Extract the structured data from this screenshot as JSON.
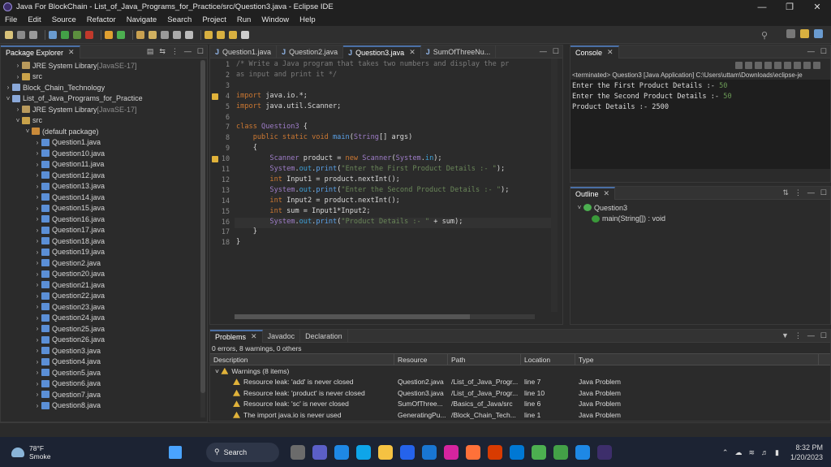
{
  "window": {
    "title": "Java For BlockChain - List_of_Java_Programs_for_Practice/src/Question3.java - Eclipse IDE",
    "minimize": "—",
    "restore": "❐",
    "close": "✕"
  },
  "menu": [
    "File",
    "Edit",
    "Source",
    "Refactor",
    "Navigate",
    "Search",
    "Project",
    "Run",
    "Window",
    "Help"
  ],
  "package_explorer": {
    "tab": "Package Explorer",
    "items": [
      {
        "indent": 1,
        "arrow": "›",
        "label": "JRE System Library",
        "suffix": " [JavaSE-17]"
      },
      {
        "indent": 1,
        "arrow": "›",
        "label": "src",
        "suffix": ""
      },
      {
        "indent": 0,
        "arrow": "›",
        "label": "Block_Chain_Technology",
        "suffix": ""
      },
      {
        "indent": 0,
        "arrow": "˅",
        "label": "List_of_Java_Programs_for_Practice",
        "suffix": ""
      },
      {
        "indent": 1,
        "arrow": "›",
        "label": "JRE System Library",
        "suffix": " [JavaSE-17]"
      },
      {
        "indent": 1,
        "arrow": "˅",
        "label": "src",
        "suffix": ""
      },
      {
        "indent": 2,
        "arrow": "˅",
        "label": "(default package)",
        "suffix": ""
      },
      {
        "indent": 3,
        "arrow": "›",
        "label": "Question1.java",
        "suffix": ""
      },
      {
        "indent": 3,
        "arrow": "›",
        "label": "Question10.java",
        "suffix": ""
      },
      {
        "indent": 3,
        "arrow": "›",
        "label": "Question11.java",
        "suffix": ""
      },
      {
        "indent": 3,
        "arrow": "›",
        "label": "Question12.java",
        "suffix": ""
      },
      {
        "indent": 3,
        "arrow": "›",
        "label": "Question13.java",
        "suffix": ""
      },
      {
        "indent": 3,
        "arrow": "›",
        "label": "Question14.java",
        "suffix": ""
      },
      {
        "indent": 3,
        "arrow": "›",
        "label": "Question15.java",
        "suffix": ""
      },
      {
        "indent": 3,
        "arrow": "›",
        "label": "Question16.java",
        "suffix": ""
      },
      {
        "indent": 3,
        "arrow": "›",
        "label": "Question17.java",
        "suffix": ""
      },
      {
        "indent": 3,
        "arrow": "›",
        "label": "Question18.java",
        "suffix": ""
      },
      {
        "indent": 3,
        "arrow": "›",
        "label": "Question19.java",
        "suffix": ""
      },
      {
        "indent": 3,
        "arrow": "›",
        "label": "Question2.java",
        "suffix": ""
      },
      {
        "indent": 3,
        "arrow": "›",
        "label": "Question20.java",
        "suffix": ""
      },
      {
        "indent": 3,
        "arrow": "›",
        "label": "Question21.java",
        "suffix": ""
      },
      {
        "indent": 3,
        "arrow": "›",
        "label": "Question22.java",
        "suffix": ""
      },
      {
        "indent": 3,
        "arrow": "›",
        "label": "Question23.java",
        "suffix": ""
      },
      {
        "indent": 3,
        "arrow": "›",
        "label": "Question24.java",
        "suffix": ""
      },
      {
        "indent": 3,
        "arrow": "›",
        "label": "Question25.java",
        "suffix": ""
      },
      {
        "indent": 3,
        "arrow": "›",
        "label": "Question26.java",
        "suffix": ""
      },
      {
        "indent": 3,
        "arrow": "›",
        "label": "Question3.java",
        "suffix": ""
      },
      {
        "indent": 3,
        "arrow": "›",
        "label": "Question4.java",
        "suffix": ""
      },
      {
        "indent": 3,
        "arrow": "›",
        "label": "Question5.java",
        "suffix": ""
      },
      {
        "indent": 3,
        "arrow": "›",
        "label": "Question6.java",
        "suffix": ""
      },
      {
        "indent": 3,
        "arrow": "›",
        "label": "Question7.java",
        "suffix": ""
      },
      {
        "indent": 3,
        "arrow": "›",
        "label": "Question8.java",
        "suffix": ""
      }
    ]
  },
  "editor": {
    "tabs": [
      {
        "label": "Question1.java",
        "active": false
      },
      {
        "label": "Question2.java",
        "active": false
      },
      {
        "label": "Question3.java",
        "active": true
      },
      {
        "label": "SumOfThreeNu...",
        "active": false
      }
    ],
    "lines": [
      {
        "n": "1",
        "tokens": [
          [
            "cmt",
            "/* Write a Java program that takes two numbers and display the pr"
          ]
        ]
      },
      {
        "n": "2",
        "tokens": [
          [
            "cmt",
            "as input and print it */"
          ]
        ]
      },
      {
        "n": "3",
        "tokens": []
      },
      {
        "n": "4",
        "tokens": [
          [
            "kw",
            "import "
          ],
          [
            "var",
            "java.io.*;"
          ]
        ]
      },
      {
        "n": "5",
        "tokens": [
          [
            "kw",
            "import "
          ],
          [
            "var",
            "java.util.Scanner;"
          ]
        ]
      },
      {
        "n": "6",
        "tokens": []
      },
      {
        "n": "7",
        "tokens": [
          [
            "kw",
            "class "
          ],
          [
            "cls",
            "Question3 "
          ],
          [
            "var",
            "{"
          ]
        ]
      },
      {
        "n": "8",
        "tokens": [
          [
            "kw",
            "    public static void "
          ],
          [
            "fn",
            "main"
          ],
          [
            "var",
            "("
          ],
          [
            "cls",
            "String"
          ],
          [
            "var",
            "[] args)"
          ]
        ]
      },
      {
        "n": "9",
        "tokens": [
          [
            "var",
            "    {"
          ]
        ]
      },
      {
        "n": "10",
        "tokens": [
          [
            "cls",
            "        Scanner "
          ],
          [
            "var",
            "product = "
          ],
          [
            "kw",
            "new "
          ],
          [
            "cls",
            "Scanner"
          ],
          [
            "var",
            "("
          ],
          [
            "cls",
            "System"
          ],
          [
            "var",
            "."
          ],
          [
            "sysc",
            "in"
          ],
          [
            "var",
            ");"
          ]
        ]
      },
      {
        "n": "11",
        "tokens": [
          [
            "cls",
            "        System"
          ],
          [
            "var",
            "."
          ],
          [
            "sysc",
            "out"
          ],
          [
            "var",
            "."
          ],
          [
            "fn",
            "print"
          ],
          [
            "var",
            "("
          ],
          [
            "str",
            "\"Enter the First Product Details :- \""
          ],
          [
            "var",
            ");"
          ]
        ]
      },
      {
        "n": "12",
        "tokens": [
          [
            "kw",
            "        int "
          ],
          [
            "var",
            "Input1 = product.nextInt();"
          ]
        ]
      },
      {
        "n": "13",
        "tokens": [
          [
            "cls",
            "        System"
          ],
          [
            "var",
            "."
          ],
          [
            "sysc",
            "out"
          ],
          [
            "var",
            "."
          ],
          [
            "fn",
            "print"
          ],
          [
            "var",
            "("
          ],
          [
            "str",
            "\"Enter the Second Product Details :- \""
          ],
          [
            "var",
            ");"
          ]
        ]
      },
      {
        "n": "14",
        "tokens": [
          [
            "kw",
            "        int "
          ],
          [
            "var",
            "Input2 = product.nextInt();"
          ]
        ]
      },
      {
        "n": "15",
        "tokens": [
          [
            "kw",
            "        int "
          ],
          [
            "var",
            "sum = Input1*Input2;"
          ]
        ]
      },
      {
        "n": "16",
        "tokens": [
          [
            "cls",
            "        System"
          ],
          [
            "var",
            "."
          ],
          [
            "sysc",
            "out"
          ],
          [
            "var",
            "."
          ],
          [
            "fn",
            "print"
          ],
          [
            "var",
            "("
          ],
          [
            "str",
            "\"Product Details :- \""
          ],
          [
            "var",
            " + sum);"
          ]
        ]
      },
      {
        "n": "17",
        "tokens": [
          [
            "var",
            "    }"
          ]
        ]
      },
      {
        "n": "18",
        "tokens": [
          [
            "var",
            "}"
          ]
        ]
      }
    ]
  },
  "console": {
    "tab": "Console",
    "status": "<terminated> Question3 [Java Application] C:\\Users\\uttam\\Downloads\\eclipse-je",
    "lines": [
      {
        "text": "Enter the First Product Details :- ",
        "value": "50"
      },
      {
        "text": "Enter the Second Product Details :- ",
        "value": "50"
      },
      {
        "text": "Product Details :- 2500",
        "value": ""
      }
    ]
  },
  "outline": {
    "tab": "Outline",
    "class": "Question3",
    "method": "main(String[]) : void"
  },
  "problems": {
    "tabs": [
      "Problems",
      "Javadoc",
      "Declaration"
    ],
    "summary": "0 errors, 8 warnings, 0 others",
    "columns": [
      "Description",
      "Resource",
      "Path",
      "Location",
      "Type"
    ],
    "group": "Warnings (8 items)",
    "rows": [
      {
        "desc": "Resource leak: 'add' is never closed",
        "resource": "Question2.java",
        "path": "/List_of_Java_Progr...",
        "location": "line 7",
        "type": "Java Problem"
      },
      {
        "desc": "Resource leak: 'product' is never closed",
        "resource": "Question3.java",
        "path": "/List_of_Java_Progr...",
        "location": "line 10",
        "type": "Java Problem"
      },
      {
        "desc": "Resource leak: 'sc' is never closed",
        "resource": "SumOfThree...",
        "path": "/Basics_of_Java/src",
        "location": "line 6",
        "type": "Java Problem"
      },
      {
        "desc": "The import java.io is never used",
        "resource": "GeneratingPu...",
        "path": "/Block_Chain_Tech...",
        "location": "line 1",
        "type": "Java Problem"
      }
    ]
  },
  "taskbar": {
    "temp": "78°F",
    "weather": "Smoke",
    "search": "Search",
    "time": "8:32 PM",
    "date": "1/20/2023"
  },
  "colors": {
    "accent": "#4a6fa5",
    "warning": "#e0b23a",
    "console_value": "#6a9955"
  }
}
